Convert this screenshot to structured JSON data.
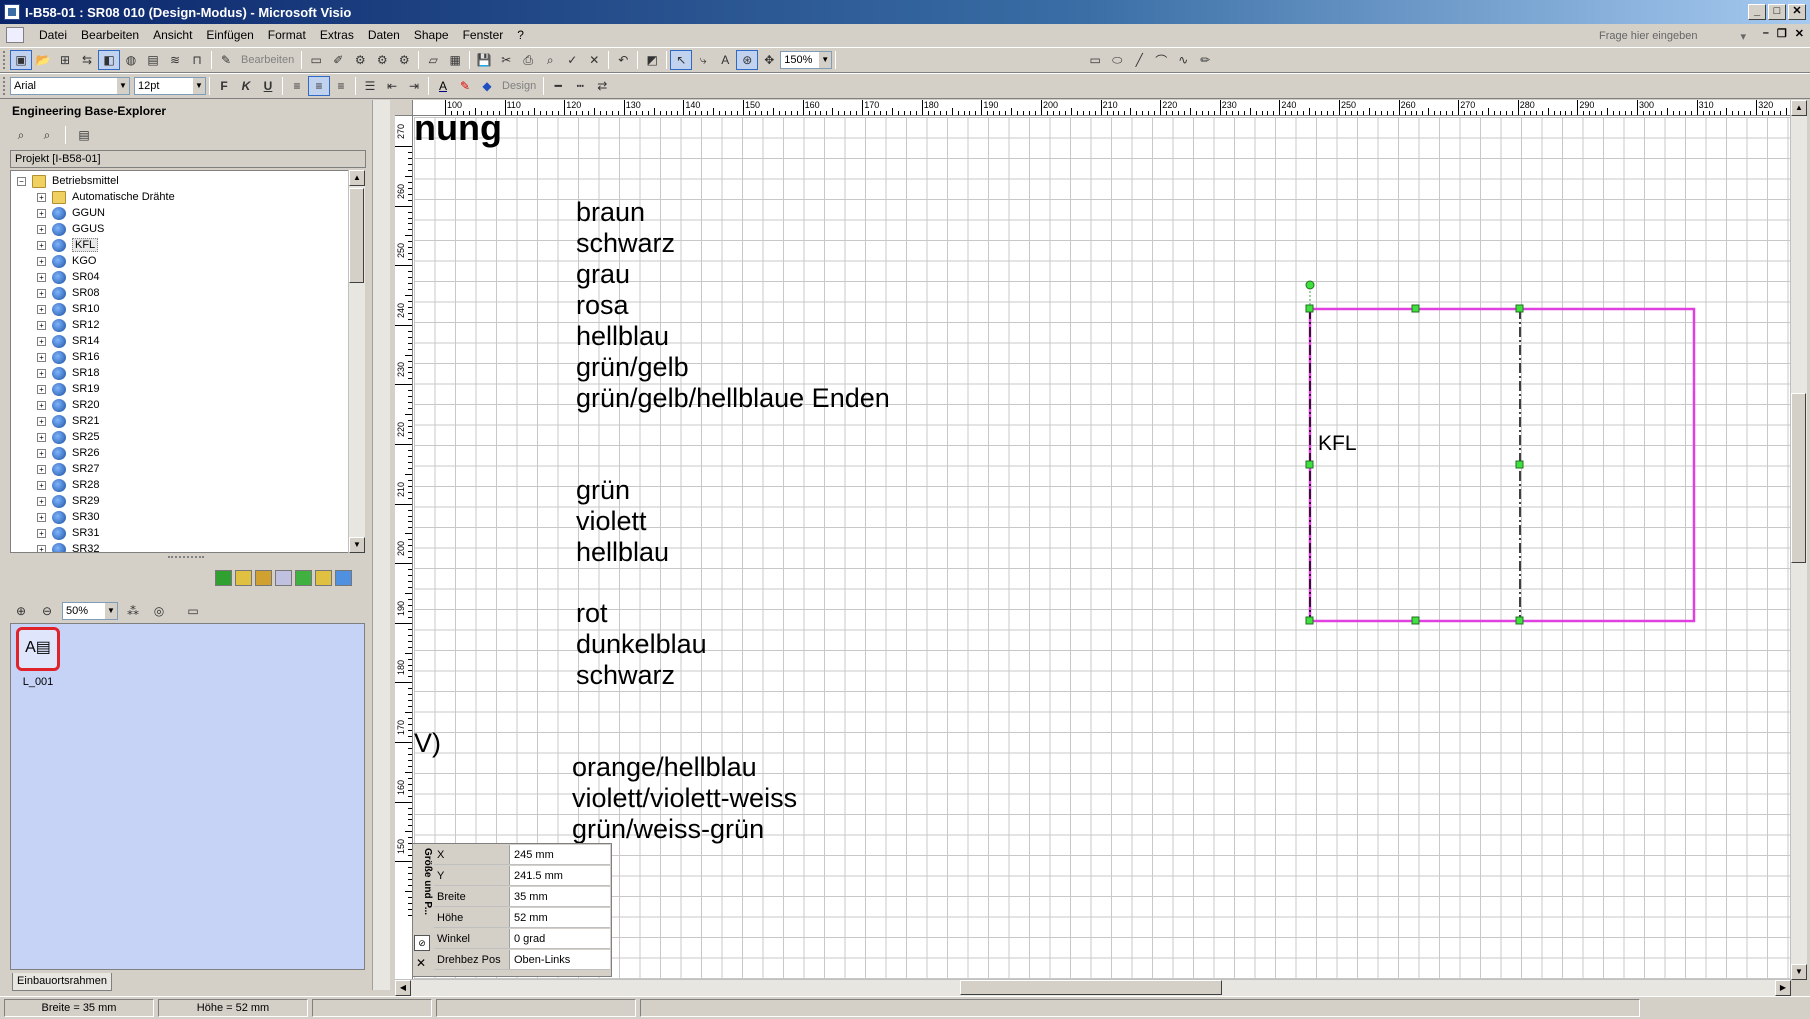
{
  "window": {
    "title": "I-B58-01 : SR08 010 (Design-Modus) - Microsoft Visio",
    "min": "_",
    "max": "□",
    "close": "✕"
  },
  "menu": [
    "Datei",
    "Bearbeiten",
    "Ansicht",
    "Einfügen",
    "Format",
    "Extras",
    "Daten",
    "Shape",
    "Fenster",
    "?"
  ],
  "help": {
    "placeholder": "Frage hier eingeben"
  },
  "toolbar": {
    "bearbeiten_label": "Bearbeiten",
    "zoom": "150%",
    "font": "Arial",
    "fontsize": "12pt",
    "bold": "F",
    "italic": "K",
    "underline": "U",
    "design_label": "Design"
  },
  "explorer": {
    "title": "Engineering Base-Explorer",
    "project": "Projekt [I-B58-01]",
    "root": "Betriebsmittel",
    "items": [
      "Automatische Drähte",
      "GGUN",
      "GGUS",
      "KFL",
      "KGO",
      "SR04",
      "SR08",
      "SR10",
      "SR12",
      "SR14",
      "SR16",
      "SR18",
      "SR19",
      "SR20",
      "SR21",
      "SR25",
      "SR26",
      "SR27",
      "SR28",
      "SR29",
      "SR30",
      "SR31",
      "SR32"
    ],
    "selected_item": "KFL",
    "zoom": "50%",
    "thumbnail_label": "L_001",
    "bottom_tab": "Einbauortsrahmen"
  },
  "ruler": {
    "h_labels": [
      "100",
      "110",
      "120",
      "130",
      "140",
      "150",
      "160",
      "170",
      "180",
      "190",
      "200",
      "210",
      "220",
      "230",
      "240",
      "250",
      "260",
      "270",
      "280",
      "290",
      "300",
      "310",
      "320"
    ],
    "v_labels": [
      "270",
      "260",
      "250",
      "240",
      "230",
      "220",
      "210",
      "200",
      "190",
      "180",
      "170",
      "160",
      "150"
    ]
  },
  "drawing": {
    "heading": "nung",
    "colors": [
      "braun",
      "schwarz",
      "grau",
      "rosa",
      "hellblau",
      "grün/gelb",
      "grün/gelb/hellblaue Enden",
      "grün",
      "violett",
      "hellblau",
      "rot",
      "dunkelblau",
      "schwarz",
      "orange/hellblau",
      "violett/violett-weiss",
      "grün/weiss-grün"
    ],
    "left_fragment": "V)",
    "shape_label": "KFL",
    "shape_color": "#e040e0"
  },
  "size_position": {
    "title": "Größe und P...",
    "rows": [
      {
        "name": "X",
        "value": "245 mm"
      },
      {
        "name": "Y",
        "value": "241.5 mm"
      },
      {
        "name": "Breite",
        "value": "35 mm"
      },
      {
        "name": "Höhe",
        "value": "52 mm"
      },
      {
        "name": "Winkel",
        "value": "0 grad"
      },
      {
        "name": "Drehbez Pos",
        "value": "Oben-Links"
      }
    ]
  },
  "status": {
    "width": "Breite = 35 mm",
    "height": "Höhe = 52 mm"
  }
}
